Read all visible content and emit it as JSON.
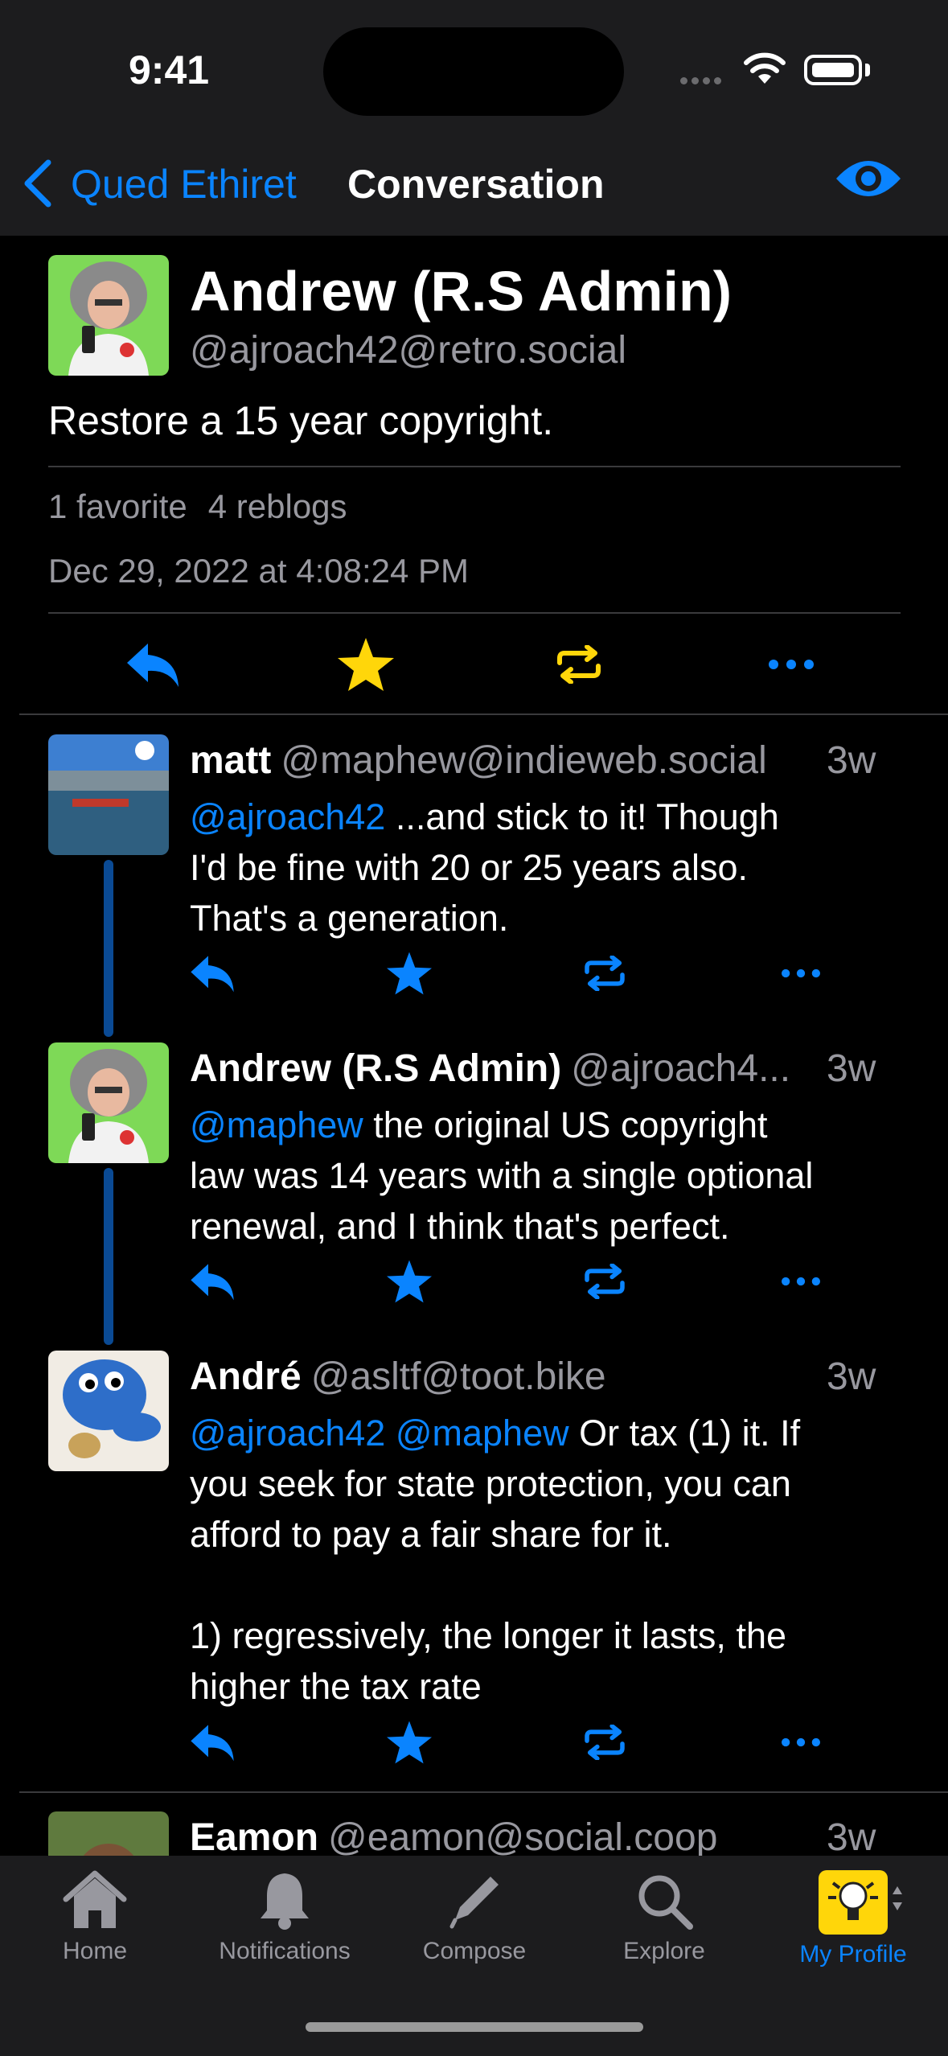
{
  "status_bar": {
    "time": "9:41"
  },
  "nav": {
    "back_label": "Qued Ethiret",
    "title": "Conversation"
  },
  "main_post": {
    "display_name": "Andrew (R.S Admin)",
    "handle": "@ajroach42@retro.social",
    "text": "Restore a 15 year copyright.",
    "favorites": "1 favorite",
    "reblogs": "4 reblogs",
    "date": "Dec 29, 2022 at 4:08:24 PM"
  },
  "replies": [
    {
      "name": "matt",
      "handle": "@maphew@indieweb.social",
      "time": "3w",
      "mention": "@ajroach42",
      "line1": " ...and stick to it! Though",
      "line2": "I'd be fine with 20 or 25 years also.",
      "line3": "That's a generation."
    },
    {
      "name": "Andrew (R.S Admin)",
      "handle": "@ajroach4...",
      "time": "3w",
      "mention": "@maphew",
      "line1": " the original US copyright",
      "line2": "law was 14 years with a single optional",
      "line3": "renewal, and I think that's perfect."
    },
    {
      "name": "André",
      "handle": "@asltf@toot.bike",
      "time": "3w",
      "mention": "@ajroach42 @maphew",
      "line1": " Or tax (1) it. If",
      "line2": "you seek for state protection, you can",
      "line3": "afford to pay a fair share for it.",
      "line4": "1) regressively, the longer it lasts, the",
      "line5": "higher the tax rate"
    },
    {
      "name": "Eamon",
      "handle": "@eamon@social.coop",
      "time": "3w"
    }
  ],
  "tabs": [
    {
      "label": "Home",
      "icon": "house-icon"
    },
    {
      "label": "Notifications",
      "icon": "bell-icon"
    },
    {
      "label": "Compose",
      "icon": "pencil-icon"
    },
    {
      "label": "Explore",
      "icon": "magnifier-icon"
    },
    {
      "label": "My Profile",
      "icon": "profile-avatar-icon"
    }
  ],
  "colors": {
    "accent": "#0a84ff",
    "favorite": "#ffd60a",
    "reblog": "#ffd60a",
    "bar": "#1c1c1e"
  }
}
